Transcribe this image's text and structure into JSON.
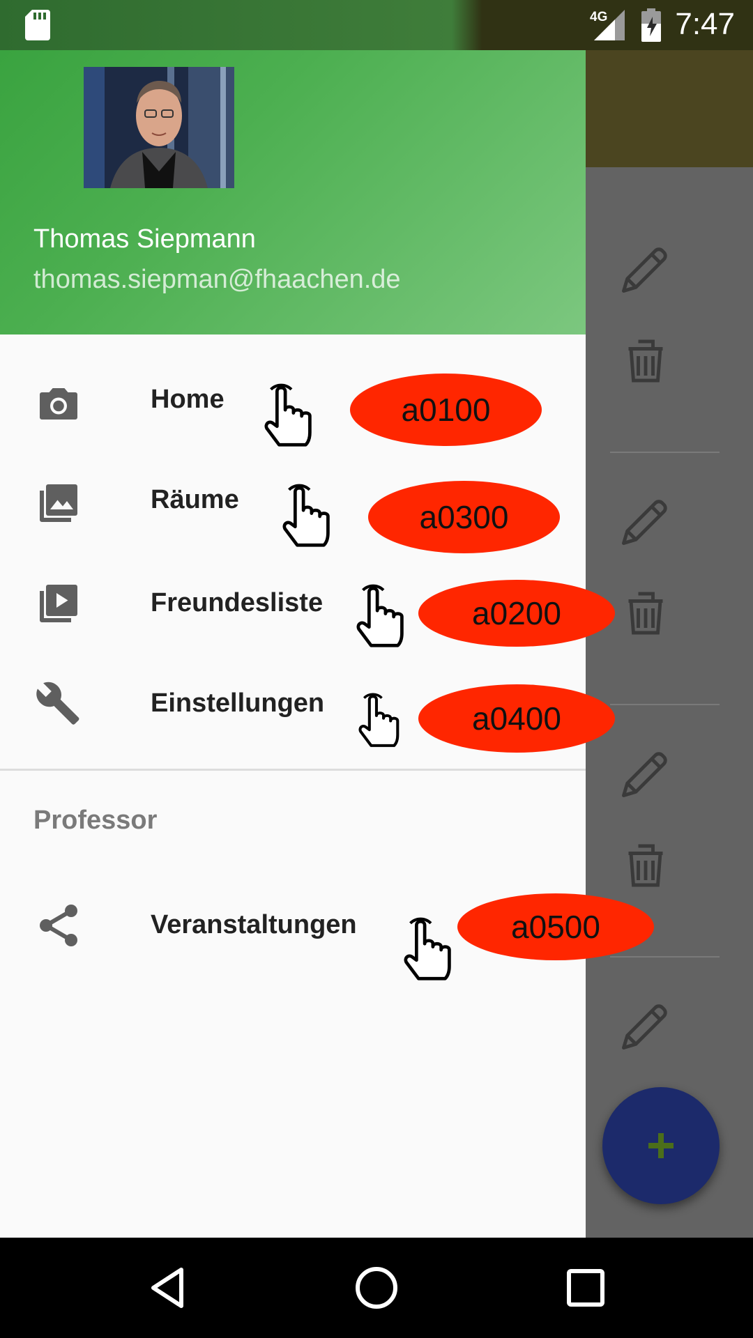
{
  "status_bar": {
    "time": "7:47",
    "network": "4G"
  },
  "drawer": {
    "user": {
      "name": "Thomas Siepmann",
      "email": "thomas.siepman@fhaachen.de"
    },
    "items": [
      {
        "label": "Home",
        "icon": "camera-icon",
        "annotation": "a0100"
      },
      {
        "label": "Räume",
        "icon": "gallery-icon",
        "annotation": "a0300"
      },
      {
        "label": "Freundesliste",
        "icon": "slideshow-icon",
        "annotation": "a0200"
      },
      {
        "label": "Einstellungen",
        "icon": "wrench-icon",
        "annotation": "a0400"
      }
    ],
    "section_header": "Professor",
    "section_items": [
      {
        "label": "Veranstaltungen",
        "icon": "share-icon",
        "annotation": "a0500"
      }
    ]
  },
  "colors": {
    "drawer_header_start": "#37a13d",
    "drawer_header_end": "#7cc77f",
    "annotation_oval": "#ff2600",
    "fab": "#1c2a6b",
    "fab_plus": "#4b6e1a",
    "background_toolbar": "#4b4520"
  }
}
